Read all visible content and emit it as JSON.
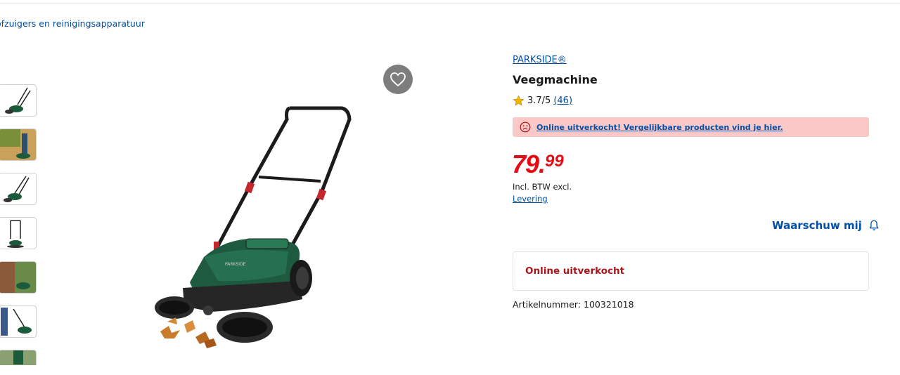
{
  "breadcrumb": {
    "label": "ofzuigers en reinigingsapparatuur"
  },
  "gallery": {
    "thumbnails": [
      "thumb-1",
      "thumb-2",
      "thumb-3",
      "thumb-4",
      "thumb-5",
      "thumb-6",
      "thumb-7"
    ],
    "favorite_icon": "heart-icon"
  },
  "product": {
    "brand": "PARKSIDE®",
    "title": "Veegmachine",
    "rating": {
      "value": "3.7/5",
      "count": "(46)",
      "icon": "star-icon"
    },
    "alert": {
      "text": "Online uitverkocht! Vergelijkbare producten vind je hier.",
      "icon": "sad-face-icon"
    },
    "price": {
      "integer": "79.",
      "decimals": "99"
    },
    "vat_note": "Incl. BTW excl.",
    "delivery_link": "Levering",
    "notify_label": "Waarschuw mij",
    "notify_icon": "bell-icon",
    "stock_status": "Online uitverkocht",
    "article_number": "Artikelnummer: 100321018"
  },
  "colors": {
    "link": "#0050aa",
    "price": "#e60a14",
    "alert_bg": "#fbc8c8",
    "out_of_stock": "#a8151a"
  }
}
